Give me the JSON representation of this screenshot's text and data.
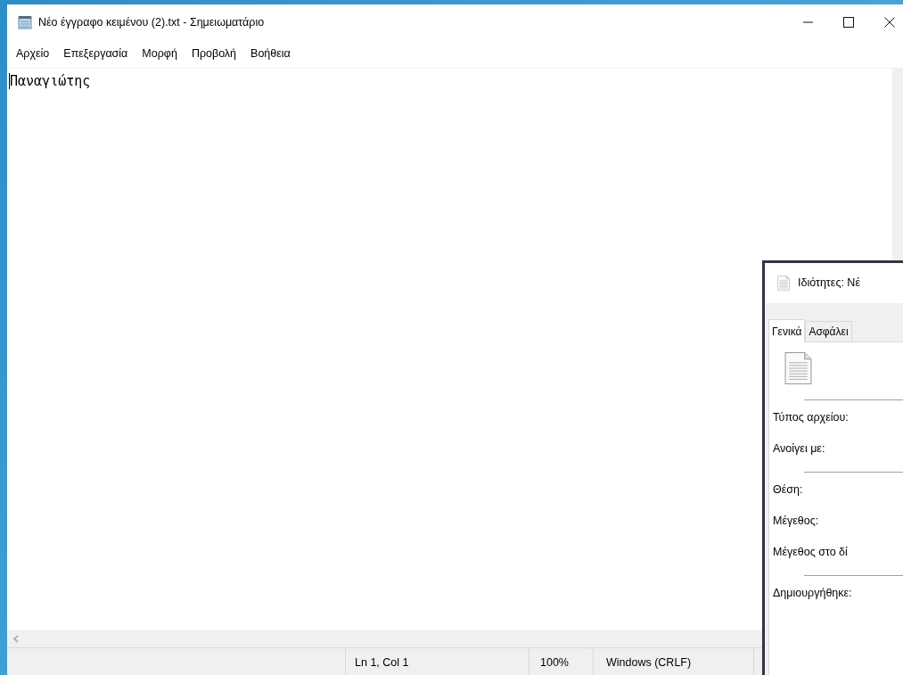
{
  "window": {
    "title": "Νέο έγγραφο κειμένου (2).txt - Σημειωματάριο"
  },
  "menu": [
    "Αρχείο",
    "Επεξεργασία",
    "Μορφή",
    "Προβολή",
    "Βοήθεια"
  ],
  "editor": {
    "text": "Παναγιώτης"
  },
  "status_bar": [
    "Ln 1, Col 1",
    "100%",
    "Windows (CRLF)"
  ],
  "dialog": {
    "title": "Ιδιότητες: Νέ",
    "tabs": [
      {
        "label": "Γενικά",
        "selected": true
      },
      {
        "label": "Ασφάλει",
        "selected": false
      }
    ],
    "groups": [
      [
        "Τύπος αρχείου:",
        "Ανοίγει με:"
      ],
      [
        "Θέση:",
        "Μέγεθος:",
        "Μέγεθος στο δί"
      ],
      [
        "Δημιουργήθηκε:"
      ]
    ]
  }
}
